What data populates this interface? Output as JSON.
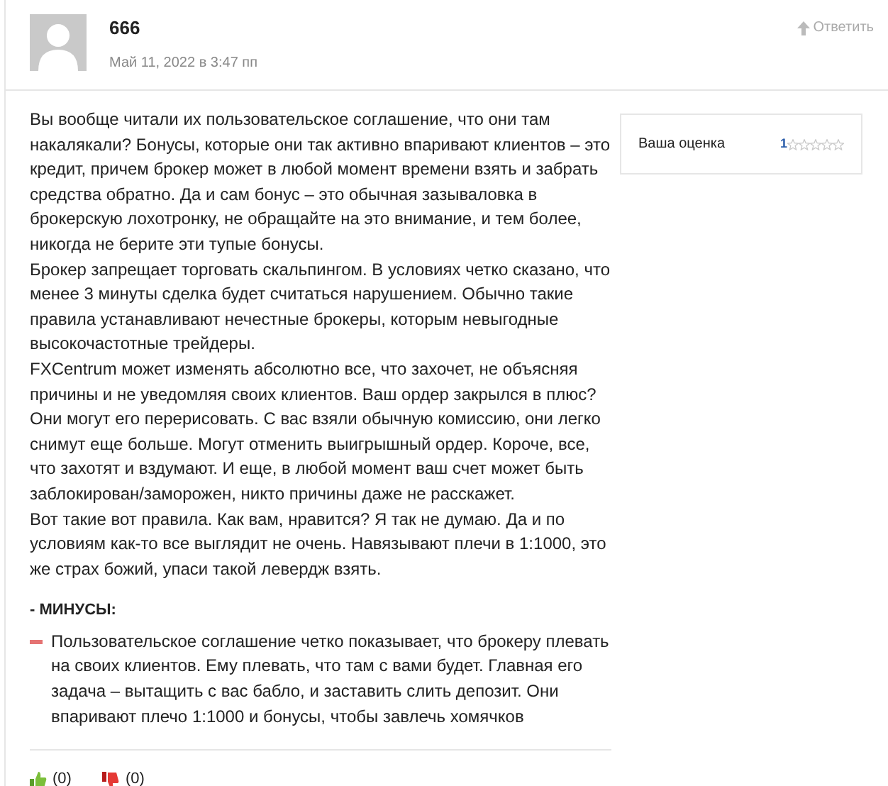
{
  "comment": {
    "author": "666",
    "date": "Май 11, 2022 в 3:47 пп",
    "reply": "Ответить"
  },
  "paragraphs": [
    "Вы вообще читали их пользовательское соглашение, что они там накалякали? Бонусы, которые они так активно впаривают клиентов – это кредит, причем брокер может в любой момент времени взять и забрать средства обратно. Да и сам бонус – это обычная зазываловка в брокерскую лохотронку, не обращайте на это внимание, и тем более, никогда не берите эти тупые бонусы.",
    "Брокер запрещает торговать скальпингом. В условиях четко сказано, что менее 3 минуты сделка будет считаться нарушением. Обычно такие правила устанавливают нечестные брокеры, которым невыгодные высокочастотные трейдеры.",
    "FXCentrum может изменять абсолютно все, что захочет, не объясняя причины и не уведомляя своих клиентов. Ваш ордер закрылся в плюс? Они могут его перерисовать. С вас взяли обычную комиссию, они легко снимут еще больше. Могут отменить выигрышный ордер. Короче, все, что захотят и вздумают. И еще, в любой момент ваш счет может быть заблокирован/заморожен, никто причины даже не расскажет.",
    "Вот такие вот правила. Как вам, нравится? Я так не думаю. Да и по условиям как-то все выглядит не очень. Навязывают плечи в 1:1000, это же страх божий, упаси такой левердж взять."
  ],
  "cons": {
    "heading": "- МИНУСЫ:",
    "items": [
      "Пользовательское соглашение четко показывает, что брокеру плевать на своих клиентов. Ему плевать, что там с вами будет. Главная его задача – вытащить с вас бабло, и заставить слить депозит. Они впаривают плечо 1:1000 и бонусы, чтобы завлечь хомячков"
    ]
  },
  "rating": {
    "label": "Ваша оценка",
    "value": "1",
    "stars": 0
  },
  "votes": [
    {
      "kind": "up",
      "count": "(0)"
    },
    {
      "kind": "down",
      "count": "(0)"
    }
  ]
}
